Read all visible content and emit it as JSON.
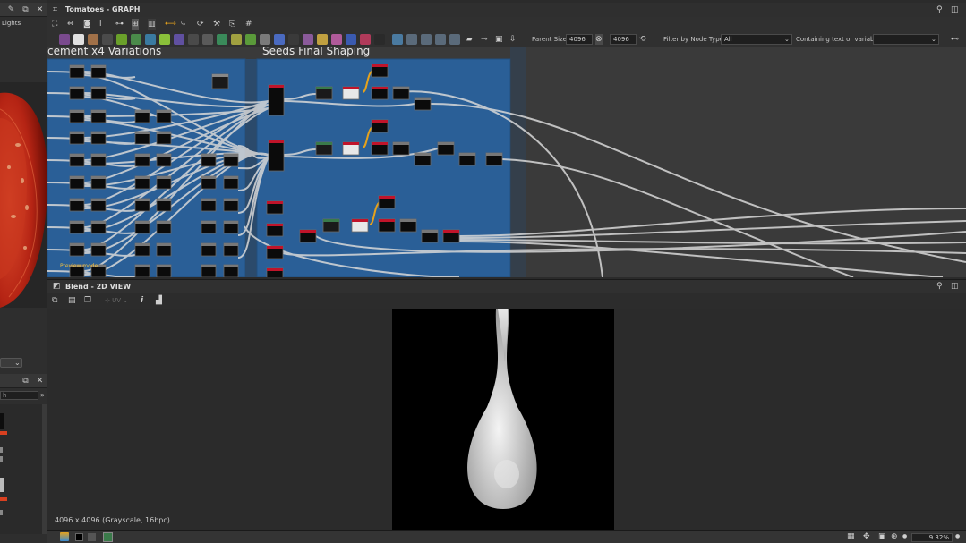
{
  "left_panel": {
    "lights_label": "Lights",
    "search_placeholder": "h"
  },
  "graph": {
    "title": "Tomatoes - GRAPH",
    "frames": [
      {
        "title": "cement x4 Variations"
      },
      {
        "title": "Seeds Final Shaping"
      }
    ],
    "frame_comment": "Preview mode",
    "toolbar": {
      "parent_size_label": "Parent Size:",
      "parent_size_value": "4096",
      "size_value": "4096",
      "filter_label": "Filter by Node Type",
      "filter_value": "All",
      "containing_label": "Containing text or variable",
      "containing_value": ""
    }
  },
  "view2d": {
    "title": "Blend - 2D VIEW",
    "toolbar_uv": "UV",
    "image_info": "4096 x 4096 (Grayscale, 16bpc)",
    "zoom": "9.32%"
  },
  "colors": {
    "frame_blue": "#2a5f97",
    "node_red": "#c0142a",
    "link_white": "#d8d8d8",
    "link_orange": "#e6a21c"
  }
}
